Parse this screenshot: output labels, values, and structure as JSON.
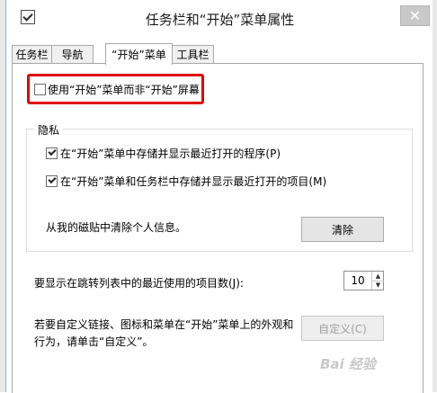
{
  "window": {
    "title": "任务栏和“开始”菜单属性",
    "close_glyph": "✕"
  },
  "tabs": [
    {
      "label": "任务栏"
    },
    {
      "label": "导航"
    },
    {
      "label": "“开始”菜单"
    },
    {
      "label": "工具栏"
    }
  ],
  "start_menu_tab": {
    "use_start_menu": {
      "label": "使用“开始”菜单而非“开始”屏幕",
      "checked": false
    },
    "privacy": {
      "legend": "隐私",
      "store_programs": {
        "label": "在“开始”菜单中存储并显示最近打开的程序(P)",
        "checked": true
      },
      "store_items": {
        "label": "在“开始”菜单和任务栏中存储并显示最近打开的项目(M)",
        "checked": true
      },
      "clear_text": "从我的磁贴中清除个人信息。",
      "clear_button": "清除"
    },
    "jump_list": {
      "label": "要显示在跳转列表中的最近使用的项目数(J):",
      "value": "10"
    },
    "customize": {
      "line1": "若要自定义链接、图标和菜单在“开始”菜单上的外观和",
      "line2": "行为，请单击“自定义”。",
      "button": "自定义(C)"
    }
  },
  "watermark": "Bai 经验"
}
